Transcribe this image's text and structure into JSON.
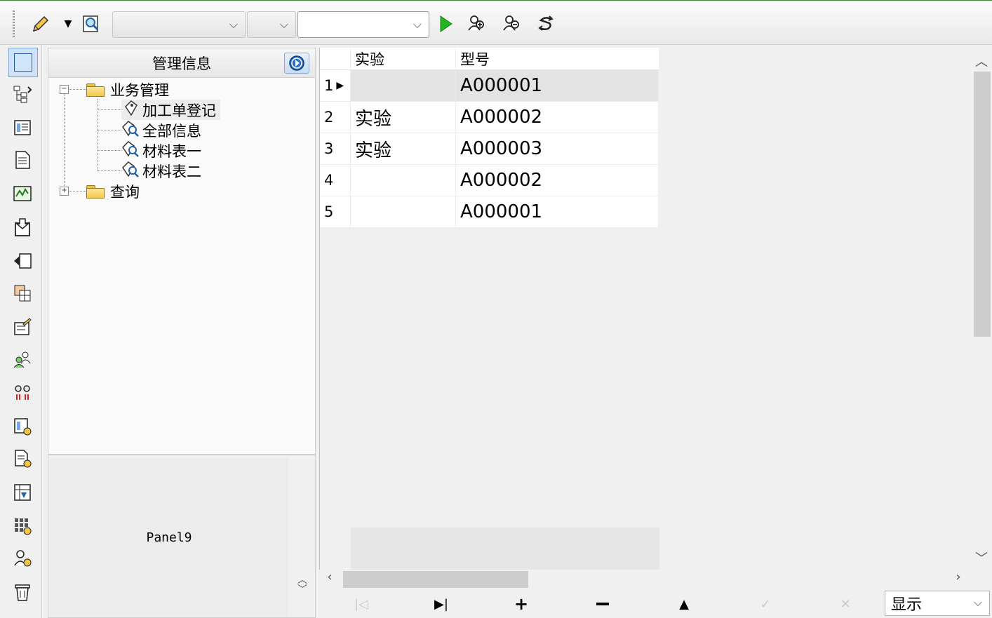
{
  "toolbar": {
    "combos": [
      {
        "value": ""
      },
      {
        "value": ""
      },
      {
        "value": ""
      }
    ],
    "icons": [
      "pencil-icon",
      "dropdown-arrow-icon",
      "search-window-icon",
      "run-icon",
      "zoom-in-user-icon",
      "zoom-out-user-icon",
      "refresh-icon"
    ]
  },
  "strip_icons": [
    "window-icon",
    "tree-view-icon",
    "list-view-icon",
    "document-icon",
    "chart-icon",
    "inbox-icon",
    "import-icon",
    "table-icon",
    "edit-form-icon",
    "users-icon",
    "link-icon",
    "report-icon",
    "doc-settings-icon",
    "grid-import-icon",
    "calculator-icon",
    "user-settings-icon",
    "trash-icon"
  ],
  "tree": {
    "header": "管理信息",
    "nodes": [
      {
        "label": "业务管理",
        "expanded": true,
        "children": [
          "加工单登记",
          "全部信息",
          "材料表一",
          "材料表二"
        ]
      },
      {
        "label": "查询",
        "expanded": false
      }
    ],
    "selected": "加工单登记"
  },
  "panel9": {
    "label": "Panel9"
  },
  "grid": {
    "columns": [
      "实验",
      "型号"
    ],
    "rows": [
      {
        "num": "1",
        "cells": [
          "",
          "A000001"
        ]
      },
      {
        "num": "2",
        "cells": [
          "实验",
          "A000002"
        ]
      },
      {
        "num": "3",
        "cells": [
          "实验",
          "A000003"
        ]
      },
      {
        "num": "4",
        "cells": [
          "",
          "A000002"
        ]
      },
      {
        "num": "5",
        "cells": [
          "",
          "A000001"
        ]
      }
    ],
    "current_row": 1
  },
  "navigator": {
    "display_select": "显示",
    "buttons": [
      "first",
      "last",
      "insert",
      "delete",
      "edit",
      "post",
      "cancel"
    ]
  },
  "colors": {
    "accent": "#3a8a3a",
    "selected_row": "#e0e0e0",
    "run": "#22b422"
  }
}
